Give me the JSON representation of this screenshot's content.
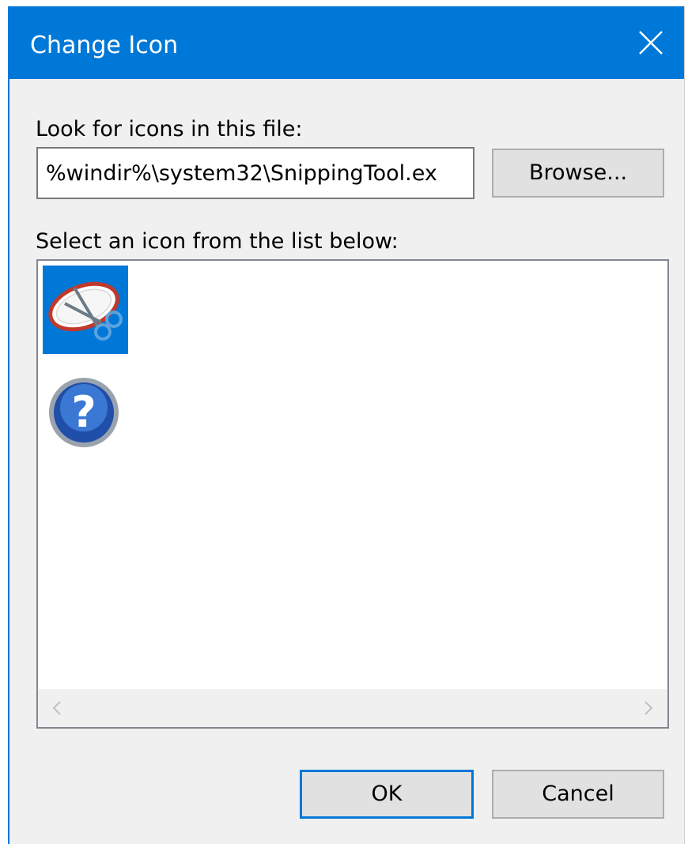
{
  "dialog": {
    "title": "Change Icon",
    "close_icon": "close-icon"
  },
  "file": {
    "label": "Look for icons in this file:",
    "value": "%windir%\\system32\\SnippingTool.ex",
    "browse_label": "Browse..."
  },
  "icon_list": {
    "label": "Select an icon from the list below:",
    "items": [
      {
        "icon": "snipping-tool-icon",
        "selected": true
      },
      {
        "icon": "help-question-icon",
        "selected": false
      }
    ],
    "scroll_left_icon": "chevron-left-icon",
    "scroll_right_icon": "chevron-right-icon"
  },
  "buttons": {
    "ok_label": "OK",
    "cancel_label": "Cancel"
  },
  "colors": {
    "accent": "#0078d7",
    "background": "#f0f0f0"
  }
}
